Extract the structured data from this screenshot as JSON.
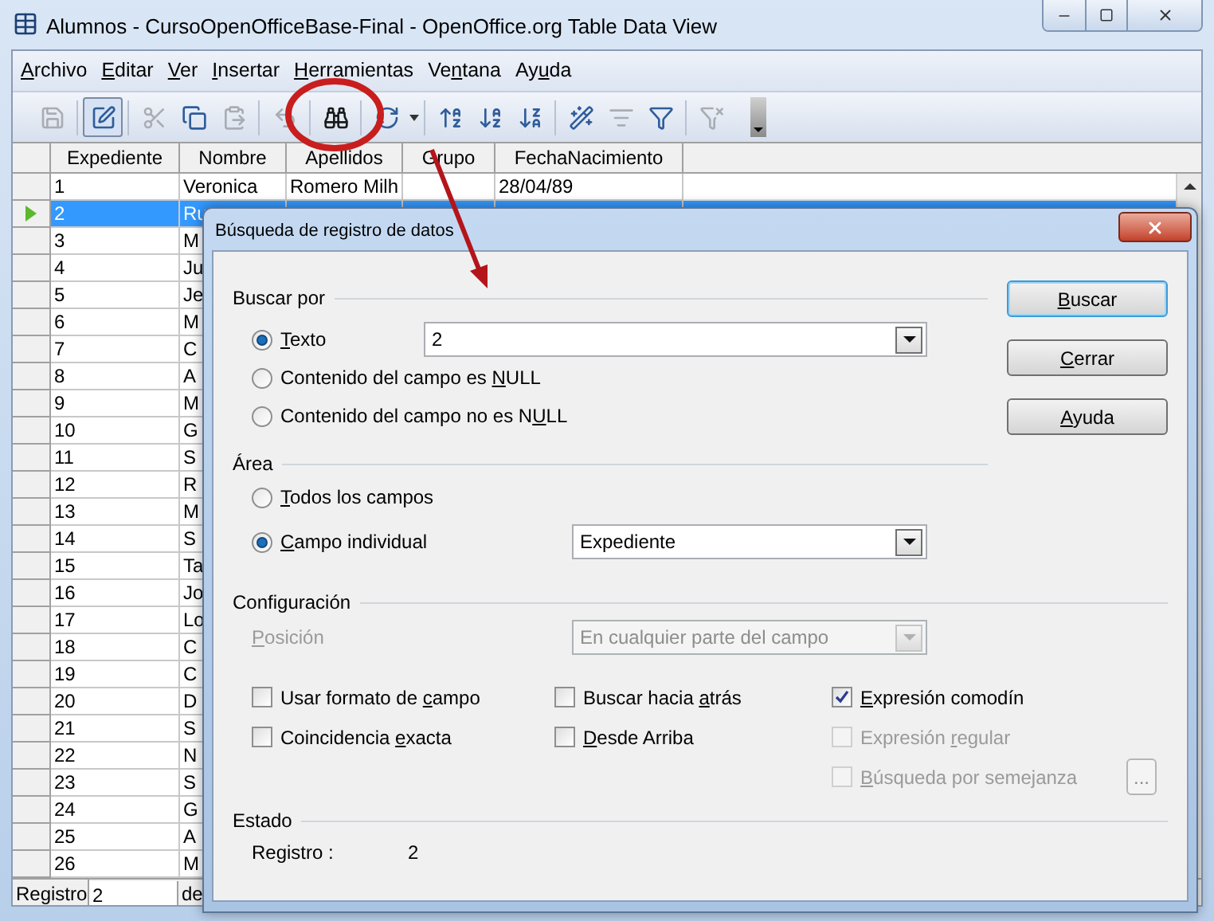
{
  "window": {
    "title": "Alumnos - CursoOpenOfficeBase-Final - OpenOffice.org Table Data View"
  },
  "menu": [
    {
      "label": {
        "key": "A",
        "post": "rchivo"
      }
    },
    {
      "label": {
        "key": "E",
        "post": "ditar"
      }
    },
    {
      "label": {
        "key": "V",
        "post": "er"
      }
    },
    {
      "label": {
        "key": "I",
        "post": "nsertar"
      }
    },
    {
      "label": {
        "key": "H",
        "post": "erramientas"
      }
    },
    {
      "label": {
        "pre": "Ve",
        "key": "n",
        "post": "tana"
      }
    },
    {
      "label": {
        "pre": "Ay",
        "key": "u",
        "post": "da"
      }
    }
  ],
  "toolbar": [
    {
      "kind": "save",
      "disabled": true,
      "pressed": false
    },
    {
      "kind": "separator"
    },
    {
      "kind": "edit",
      "disabled": false,
      "pressed": true
    },
    {
      "kind": "separator"
    },
    {
      "kind": "cut",
      "disabled": true,
      "pressed": false
    },
    {
      "kind": "copy",
      "disabled": false,
      "pressed": false
    },
    {
      "kind": "paste",
      "disabled": true,
      "pressed": false
    },
    {
      "kind": "separator"
    },
    {
      "kind": "undo",
      "disabled": true,
      "pressed": false
    },
    {
      "kind": "separator"
    },
    {
      "kind": "find",
      "disabled": false,
      "pressed": false
    },
    {
      "kind": "separator"
    },
    {
      "kind": "refresh",
      "disabled": false,
      "pressed": false,
      "dropdown": true
    },
    {
      "kind": "separator"
    },
    {
      "kind": "sort",
      "disabled": false,
      "pressed": false
    },
    {
      "kind": "sort_asc",
      "disabled": false,
      "pressed": false
    },
    {
      "kind": "sort_desc",
      "disabled": false,
      "pressed": false
    },
    {
      "kind": "separator"
    },
    {
      "kind": "autofilter",
      "disabled": false,
      "pressed": false
    },
    {
      "kind": "standard_filter",
      "disabled": true,
      "pressed": false
    },
    {
      "kind": "filter",
      "disabled": false,
      "pressed": false
    },
    {
      "kind": "separator"
    },
    {
      "kind": "remove_filter",
      "disabled": true,
      "pressed": false
    }
  ],
  "grid": {
    "columns": [
      "Expediente",
      "Nombre",
      "Apellidos",
      "Grupo",
      "FechaNacimiento"
    ],
    "rows": [
      {
        "expediente": "1",
        "nombre": "Veronica",
        "apellidos": "Romero Milh",
        "fecha": "28/04/89",
        "selected": false
      },
      {
        "expediente": "2",
        "nombre": "Ru",
        "selected": true
      },
      {
        "expediente": "3",
        "nombre": "M",
        "selected": false
      },
      {
        "expediente": "4",
        "nombre": "Ju",
        "selected": false
      },
      {
        "expediente": "5",
        "nombre": "Je",
        "selected": false
      },
      {
        "expediente": "6",
        "nombre": "M",
        "selected": false
      },
      {
        "expediente": "7",
        "nombre": "C",
        "selected": false
      },
      {
        "expediente": "8",
        "nombre": "A",
        "selected": false
      },
      {
        "expediente": "9",
        "nombre": "M",
        "selected": false
      },
      {
        "expediente": "10",
        "nombre": "G",
        "selected": false
      },
      {
        "expediente": "11",
        "nombre": "S",
        "selected": false
      },
      {
        "expediente": "12",
        "nombre": "R",
        "selected": false
      },
      {
        "expediente": "13",
        "nombre": "M",
        "selected": false
      },
      {
        "expediente": "14",
        "nombre": "S",
        "selected": false
      },
      {
        "expediente": "15",
        "nombre": "Ta",
        "selected": false
      },
      {
        "expediente": "16",
        "nombre": "Jo",
        "selected": false
      },
      {
        "expediente": "17",
        "nombre": "Lo",
        "selected": false
      },
      {
        "expediente": "18",
        "nombre": "C",
        "selected": false
      },
      {
        "expediente": "19",
        "nombre": "C",
        "selected": false
      },
      {
        "expediente": "20",
        "nombre": "D",
        "selected": false
      },
      {
        "expediente": "21",
        "nombre": "S",
        "selected": false
      },
      {
        "expediente": "22",
        "nombre": "N",
        "selected": false
      },
      {
        "expediente": "23",
        "nombre": "S",
        "selected": false
      },
      {
        "expediente": "24",
        "nombre": "G",
        "selected": false
      },
      {
        "expediente": "25",
        "nombre": "A",
        "selected": false
      },
      {
        "expediente": "26",
        "nombre": "M",
        "selected": false
      }
    ]
  },
  "record_bar": {
    "label": "Registro",
    "value": "2",
    "of": "de"
  },
  "dialog": {
    "title": "Búsqueda de registro de datos",
    "search_by": {
      "heading": "Buscar por",
      "options": [
        {
          "label": {
            "key": "T",
            "post": "exto"
          },
          "selected": true,
          "field": {
            "value": "2"
          }
        },
        {
          "label": {
            "pre": "Contenido del campo es ",
            "key": "N",
            "post": "ULL"
          },
          "selected": false
        },
        {
          "label": {
            "pre": "Contenido del campo no es N",
            "key": "U",
            "post": "LL"
          },
          "selected": false
        }
      ]
    },
    "area": {
      "heading": "Área",
      "options": [
        {
          "label": {
            "key": "T",
            "post": "odos los campos"
          },
          "selected": false
        },
        {
          "label": {
            "key": "C",
            "post": "ampo individual"
          },
          "selected": true,
          "field": {
            "value": "Expediente"
          }
        }
      ]
    },
    "buttons": [
      {
        "label": {
          "key": "B",
          "post": "uscar"
        },
        "default": true
      },
      {
        "label": {
          "key": "C",
          "post": "errar"
        },
        "default": false
      },
      {
        "label": {
          "key": "A",
          "post": "yuda"
        },
        "default": false
      }
    ],
    "settings": {
      "heading": "Configuración",
      "position": {
        "label": {
          "key": "P",
          "post": "osición"
        },
        "value": "En cualquier parte del campo",
        "disabled": true
      },
      "option_columns": [
        [
          {
            "label": {
              "pre": "Usar formato de ",
              "key": "c",
              "post": "ampo"
            },
            "checked": false,
            "disabled": false
          },
          {
            "label": {
              "pre": "Coincidencia ",
              "key": "e",
              "post": "xacta"
            },
            "checked": false,
            "disabled": false
          }
        ],
        [
          {
            "label": {
              "pre": "Buscar hacia ",
              "key": "a",
              "post": "trás"
            },
            "checked": false,
            "disabled": false
          },
          {
            "label": {
              "key": "D",
              "post": "esde Arriba"
            },
            "checked": false,
            "disabled": false
          }
        ],
        [
          {
            "label": {
              "key": "E",
              "post": "xpresión comodín"
            },
            "checked": true,
            "disabled": false
          },
          {
            "label": {
              "pre": "Expresión ",
              "key": "r",
              "post": "egular"
            },
            "checked": false,
            "disabled": true
          },
          {
            "label": {
              "key": "B",
              "post": "úsqueda por semejanza"
            },
            "checked": false,
            "disabled": true,
            "button": {
              "label": "...",
              "disabled": true
            }
          }
        ]
      ]
    },
    "status": {
      "heading": "Estado",
      "label": "Registro :",
      "value": "2"
    }
  }
}
